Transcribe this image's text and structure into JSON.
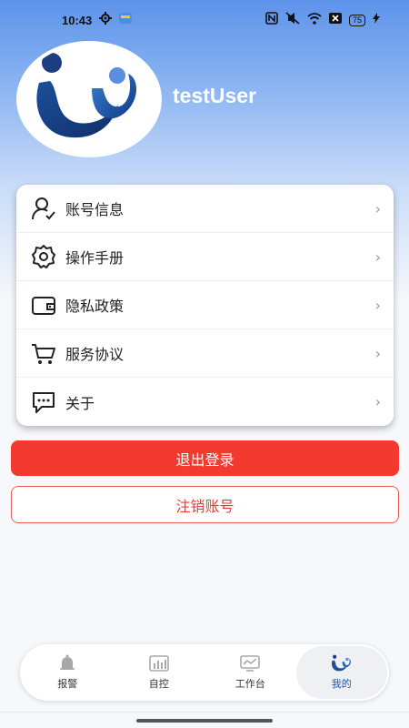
{
  "status_bar": {
    "time": "10:43",
    "battery": "75",
    "icons": [
      "settings-icon",
      "app-notification-icon",
      "nfc-icon",
      "mute-icon",
      "wifi-icon",
      "sim-icon",
      "battery-icon",
      "charging-icon"
    ]
  },
  "profile": {
    "username": "testUser",
    "avatar_icon": "app-logo-icon"
  },
  "menu": {
    "items": [
      {
        "label": "账号信息",
        "icon": "user-icon"
      },
      {
        "label": "操作手册",
        "icon": "gear-icon"
      },
      {
        "label": "隐私政策",
        "icon": "wallet-icon"
      },
      {
        "label": "服务协议",
        "icon": "cart-icon"
      },
      {
        "label": "关于",
        "icon": "chat-icon"
      }
    ],
    "chevron": "›"
  },
  "actions": {
    "logout_label": "退出登录",
    "cancel_account_label": "注销账号"
  },
  "tabs": [
    {
      "label": "报警",
      "icon": "bell-icon",
      "active": false
    },
    {
      "label": "自控",
      "icon": "bar-chart-icon",
      "active": false
    },
    {
      "label": "工作台",
      "icon": "line-chart-icon",
      "active": false
    },
    {
      "label": "我的",
      "icon": "app-logo-icon",
      "active": true
    }
  ],
  "colors": {
    "primary_red": "#f23a30",
    "accent_blue": "#1a55b0"
  }
}
